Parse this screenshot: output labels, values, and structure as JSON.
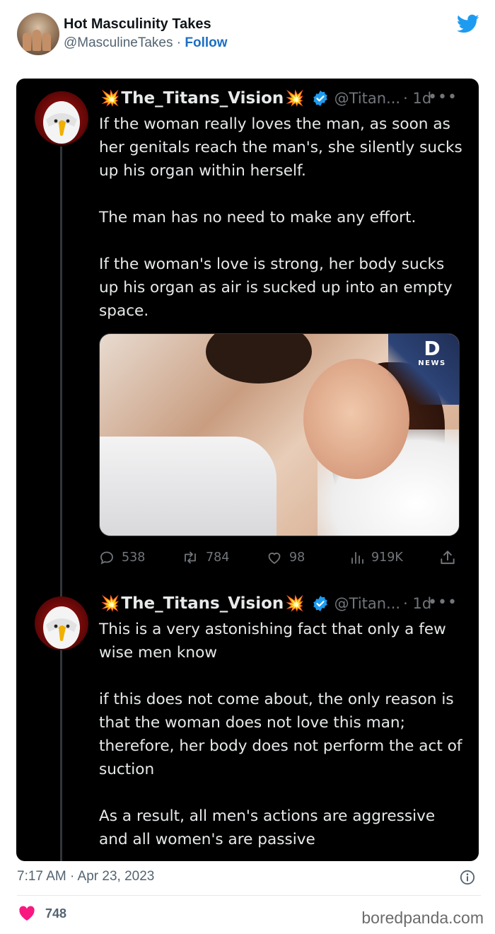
{
  "embed": {
    "display_name": "Hot Masculinity Takes",
    "handle": "@MasculineTakes",
    "separator": " · ",
    "follow_label": "Follow",
    "time": "7:17 AM · Apr 23, 2023",
    "likes": "748"
  },
  "tweets": [
    {
      "burst_left": "💥",
      "name": "The_Titans_Vision",
      "burst_right": "💥",
      "handle": "@Titan...",
      "age": "· 1d",
      "paragraphs": [
        "If the woman really loves the man, as soon as her genitals reach the man's, she silently sucks up his organ within herself.",
        "The man has no need to make any effort.",
        "If the woman's love is strong, her body sucks up his organ as air is sucked up into an empty space."
      ],
      "media_logo": {
        "mark": "D",
        "label": "NEWS"
      },
      "stats": {
        "replies": "538",
        "retweets": "784",
        "likes": "98",
        "views": "919K"
      }
    },
    {
      "burst_left": "💥",
      "name": "The_Titans_Vision",
      "burst_right": "💥",
      "handle": "@Titan...",
      "age": "· 1d",
      "paragraphs": [
        "This is a very astonishing fact that only a few wise men know",
        "if this does not come about, the only reason is that the woman does not love this man; therefore, her body does not perform the act of suction",
        "As a result, all men's actions are aggressive and all women's are passive"
      ]
    }
  ],
  "icons": {
    "brand": "twitter-bird-icon",
    "verified": "verified-badge-icon",
    "reply": "reply-icon",
    "retweet": "retweet-icon",
    "like": "heart-icon",
    "views": "views-chart-icon",
    "share": "share-icon",
    "info": "info-icon"
  },
  "watermark": "boredpanda.com",
  "colors": {
    "twitter_blue": "#1d9bf0",
    "follow_blue": "#1d6fc4",
    "heart": "#f91880",
    "dark_bg": "#000000",
    "dark_text": "#e7e9ea",
    "dark_muted": "#71767b"
  }
}
